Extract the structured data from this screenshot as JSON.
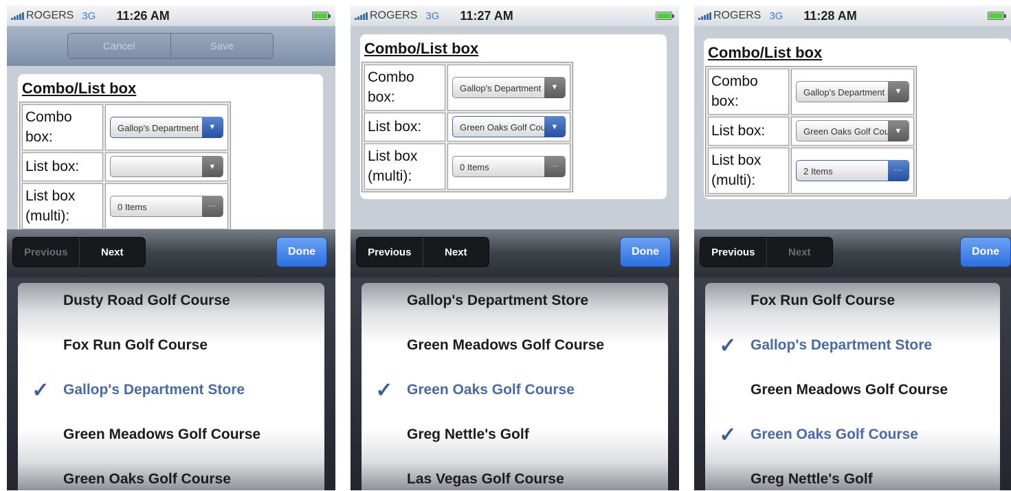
{
  "screens": [
    {
      "status": {
        "carrier": "ROGERS",
        "network": "3G",
        "time": "11:26 AM"
      },
      "nav": {
        "cancel": "Cancel",
        "save": "Save"
      },
      "form": {
        "title": "Combo/List box",
        "combo_label": "Combo box:",
        "combo_value": "Gallop's Department Store",
        "list_label": "List box:",
        "list_value": "",
        "multi_label": "List box (multi):",
        "multi_value": "0 Items"
      },
      "toolbar": {
        "previous": "Previous",
        "next": "Next",
        "done": "Done"
      },
      "picker": [
        {
          "label": "Dusty Road Golf Course",
          "checked": false
        },
        {
          "label": "Fox Run Golf Course",
          "checked": false
        },
        {
          "label": "Gallop's Department Store",
          "checked": true
        },
        {
          "label": "Green Meadows Golf Course",
          "checked": false
        },
        {
          "label": "Green Oaks Golf Course",
          "checked": false
        }
      ]
    },
    {
      "status": {
        "carrier": "ROGERS",
        "network": "3G",
        "time": "11:27 AM"
      },
      "form": {
        "title": "Combo/List box",
        "combo_label": "Combo box:",
        "combo_value": "Gallop's Department Store",
        "list_label": "List box:",
        "list_value": "Green Oaks Golf Course",
        "multi_label": "List box (multi):",
        "multi_value": "0 Items"
      },
      "toolbar": {
        "previous": "Previous",
        "next": "Next",
        "done": "Done"
      },
      "picker": [
        {
          "label": "Gallop's Department Store",
          "checked": false
        },
        {
          "label": "Green Meadows Golf Course",
          "checked": false
        },
        {
          "label": "Green Oaks Golf Course",
          "checked": true
        },
        {
          "label": "Greg Nettle's Golf",
          "checked": false
        },
        {
          "label": "Las Vegas Golf Course",
          "checked": false
        }
      ]
    },
    {
      "status": {
        "carrier": "ROGERS",
        "network": "3G",
        "time": "11:28 AM"
      },
      "form": {
        "title": "Combo/List box",
        "combo_label": "Combo box:",
        "combo_value": "Gallop's Department Store",
        "list_label": "List box:",
        "list_value": "Green Oaks Golf Course",
        "multi_label": "List box (multi):",
        "multi_value": "2 Items"
      },
      "toolbar": {
        "previous": "Previous",
        "next": "Next",
        "done": "Done"
      },
      "picker": [
        {
          "label": "Fox Run Golf Course",
          "checked": false
        },
        {
          "label": "Gallop's Department Store",
          "checked": true
        },
        {
          "label": "Green Meadows Golf Course",
          "checked": false
        },
        {
          "label": "Green Oaks Golf Course",
          "checked": true
        },
        {
          "label": "Greg Nettle's Golf",
          "checked": false
        }
      ]
    }
  ],
  "icons": {
    "dropdown": "triangle-down-icon",
    "multi": "ellipsis-icon",
    "check": "checkmark-icon"
  },
  "colors": {
    "accent_blue": "#2e6fe0",
    "checked_text": "#4a6aa6"
  }
}
